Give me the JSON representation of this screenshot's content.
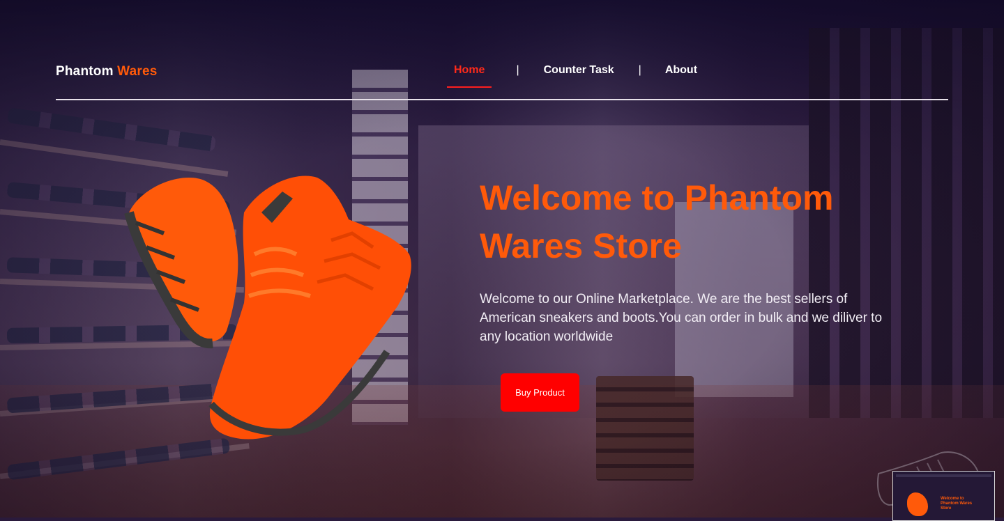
{
  "brand": {
    "name_part1": "Phantom",
    "name_part2": "Wares"
  },
  "nav": {
    "items": [
      {
        "label": "Home",
        "active": true
      },
      {
        "label": "Counter Task",
        "active": false
      },
      {
        "label": "About",
        "active": false
      }
    ],
    "separator": "|"
  },
  "hero": {
    "title": "Welcome to Phantom Wares Store",
    "description": "Welcome to our Online Marketplace. We are the best sellers of American sneakers and boots.You can order in bulk and we diliver to any location worldwide",
    "button_label": "Buy Product"
  },
  "thumbnail": {
    "title": "Welcome to Phantom Wares Store"
  },
  "colors": {
    "accent": "#ff5a0a",
    "button": "#ff0000",
    "active_nav": "#ff2a1a"
  }
}
